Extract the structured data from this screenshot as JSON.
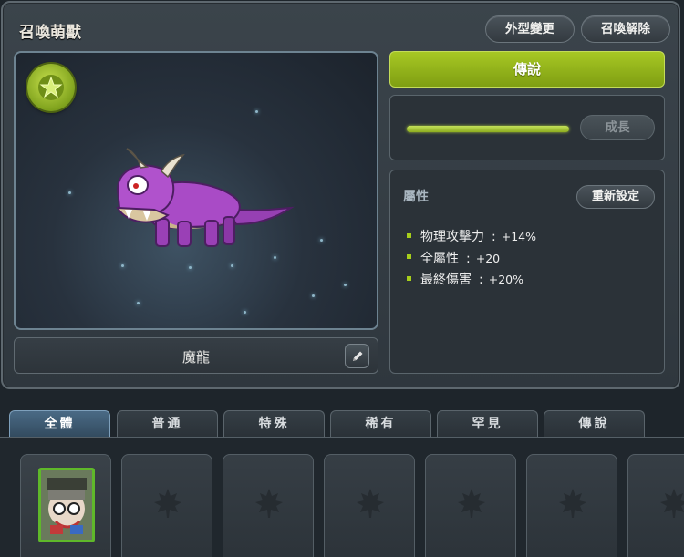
{
  "window": {
    "title": "召喚萌獸",
    "appearance_button": "外型變更",
    "release_button": "召喚解除"
  },
  "pet": {
    "name": "魔龍",
    "rank": "傳說",
    "growth_button": "成長",
    "growth_progress": 1.0,
    "badge_icon": "star-icon"
  },
  "attributes": {
    "title": "屬性",
    "reset_button": "重新設定",
    "items": [
      {
        "name": "物理攻擊力",
        "sep": ":",
        "value": "+14%"
      },
      {
        "name": "全屬性",
        "sep": ":",
        "value": "+20"
      },
      {
        "name": "最終傷害",
        "sep": ":",
        "value": "+20%"
      }
    ]
  },
  "tabs": [
    {
      "label": "全體",
      "active": true
    },
    {
      "label": "普通",
      "active": false
    },
    {
      "label": "特殊",
      "active": false
    },
    {
      "label": "稀有",
      "active": false
    },
    {
      "label": "罕見",
      "active": false
    },
    {
      "label": "傳說",
      "active": false
    }
  ],
  "colors": {
    "accent_green": "#9bbd1f",
    "slot_border": "#545e65",
    "card_border": "#5fb82a"
  }
}
